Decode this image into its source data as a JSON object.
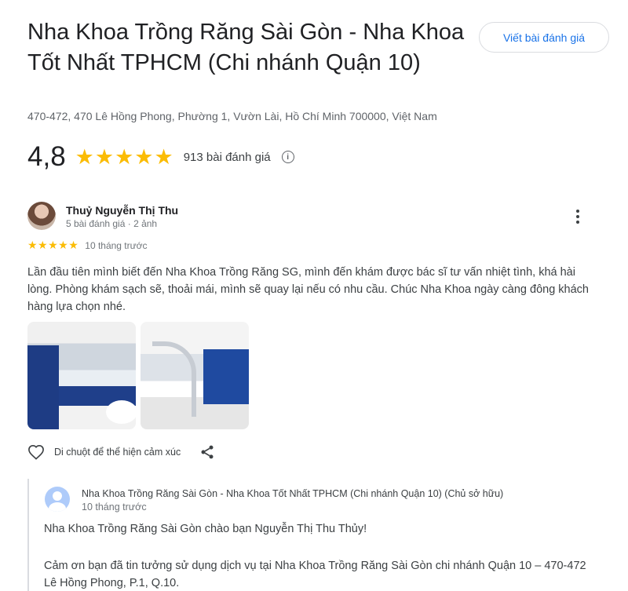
{
  "place": {
    "title": "Nha Khoa Trồng Răng Sài Gòn - Nha Khoa Tốt Nhất TPHCM (Chi nhánh Quận 10)",
    "address": "470-472, 470 Lê Hồng Phong, Phường 1, Vườn Lài, Hồ Chí Minh 700000, Việt Nam",
    "write_review_label": "Viết bài đánh giá",
    "rating": "4,8",
    "rating_stars": 5,
    "review_count": "913 bài đánh giá",
    "info_icon": "info-icon"
  },
  "review": {
    "reviewer_name": "Thuỷ Nguyễn Thị Thu",
    "reviewer_meta": "5 bài đánh giá · 2 ảnh",
    "stars": 5,
    "time": "10 tháng trước",
    "text": "Lần đầu tiên mình biết đến Nha Khoa Trồng Răng SG, mình đến khám được bác sĩ tư vấn nhiệt tình, khá hài lòng. Phòng khám sạch sẽ, thoải mái, mình sẽ quay lại nếu có nhu cầu. Chúc Nha Khoa ngày càng đông khách hàng lựa chọn nhé.",
    "react_label": "Di chuột để thể hiện cảm xúc",
    "icons": [
      "heart-icon",
      "share-icon",
      "more-vertical-icon"
    ]
  },
  "owner_reply": {
    "name": "Nha Khoa Trồng Răng Sài Gòn - Nha Khoa Tốt Nhất TPHCM (Chi nhánh Quận 10) (Chủ sở hữu)",
    "time": "10 tháng trước",
    "greeting": "Nha Khoa Trồng Răng Sài Gòn chào bạn Nguyễn Thị Thu Thủy!",
    "text": "Cảm ơn bạn đã tin tưởng sử dụng dịch vụ tại Nha Khoa Trồng Răng Sài Gòn chi nhánh Quận 10 – 470-472 Lê Hồng Phong, P.1, Q.10."
  },
  "colors": {
    "star": "#fbbc04",
    "link_blue": "#1a73e8",
    "text": "#202124",
    "muted": "#70757a"
  }
}
